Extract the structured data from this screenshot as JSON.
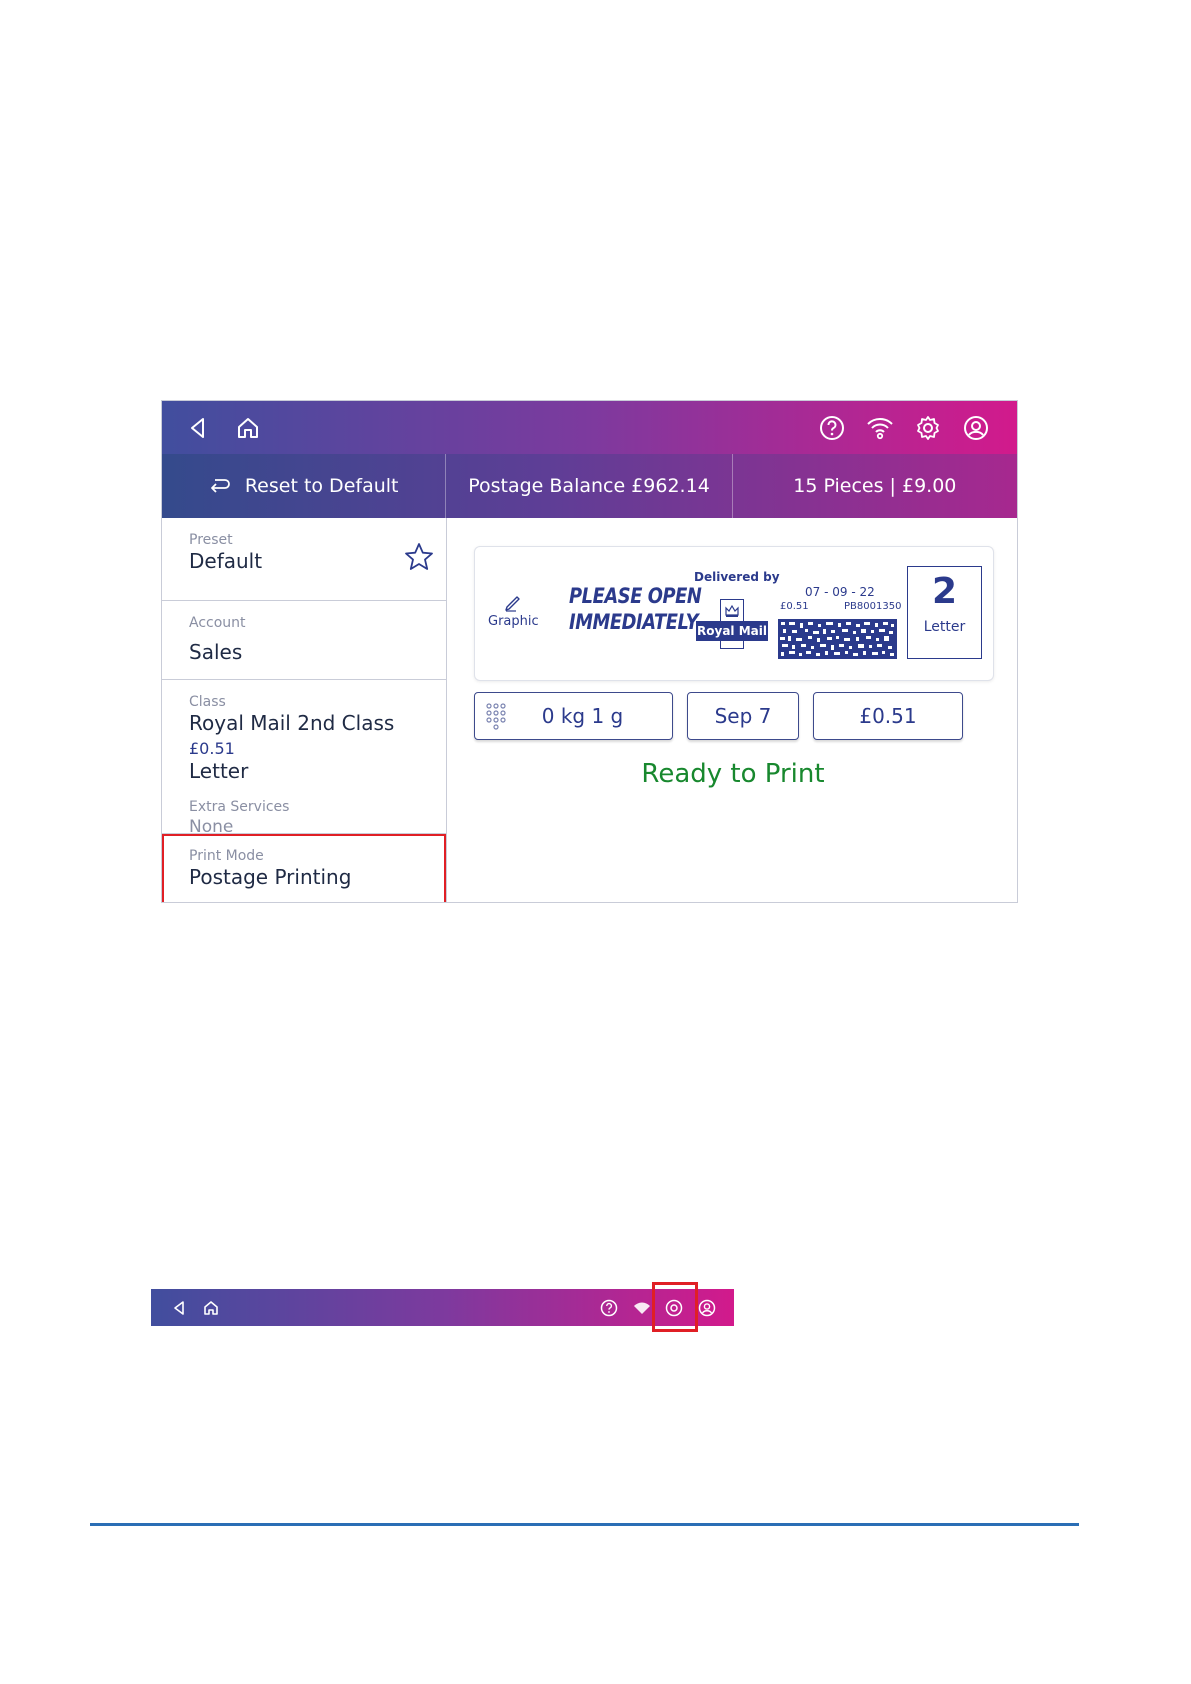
{
  "topbar": {
    "icons": [
      "back-icon",
      "home-icon",
      "help-icon",
      "wifi-icon",
      "settings-icon",
      "account-icon"
    ]
  },
  "subbar": {
    "reset_label": "Reset to Default",
    "balance_label": "Postage Balance £962.14",
    "pieces_label": "15 Pieces | £9.00"
  },
  "left": {
    "preset_caption": "Preset",
    "preset_value": "Default",
    "account_caption": "Account",
    "account_value": "Sales",
    "class_caption": "Class",
    "class_value": "Royal Mail 2nd Class",
    "class_price": "£0.51",
    "class_value2": "Letter",
    "extra_caption": "Extra Services",
    "extra_value": "None",
    "printmode_caption": "Print Mode",
    "printmode_value": "Postage Printing"
  },
  "stamp": {
    "graphic_label": "Graphic",
    "message_line1": "PLEASE OPEN",
    "message_line2": "IMMEDIATELY",
    "delivered_by": "Delivered by",
    "carrier_logo": "Royal Mail",
    "date": "07 - 09 - 22",
    "amount": "£0.51",
    "code": "PB8001350",
    "count_number": "2",
    "count_label": "Letter"
  },
  "controls": {
    "weight": "0 kg 1 g",
    "date": "Sep 7",
    "price": "£0.51"
  },
  "status": "Ready to Print",
  "colors": {
    "brand_gradient_start": "#414e9e",
    "brand_gradient_end": "#d21a8c",
    "accent_navy": "#2b3a8c",
    "ready_green": "#18882e",
    "highlight_red": "#e01f25",
    "rule_blue": "#2a6eb5"
  }
}
